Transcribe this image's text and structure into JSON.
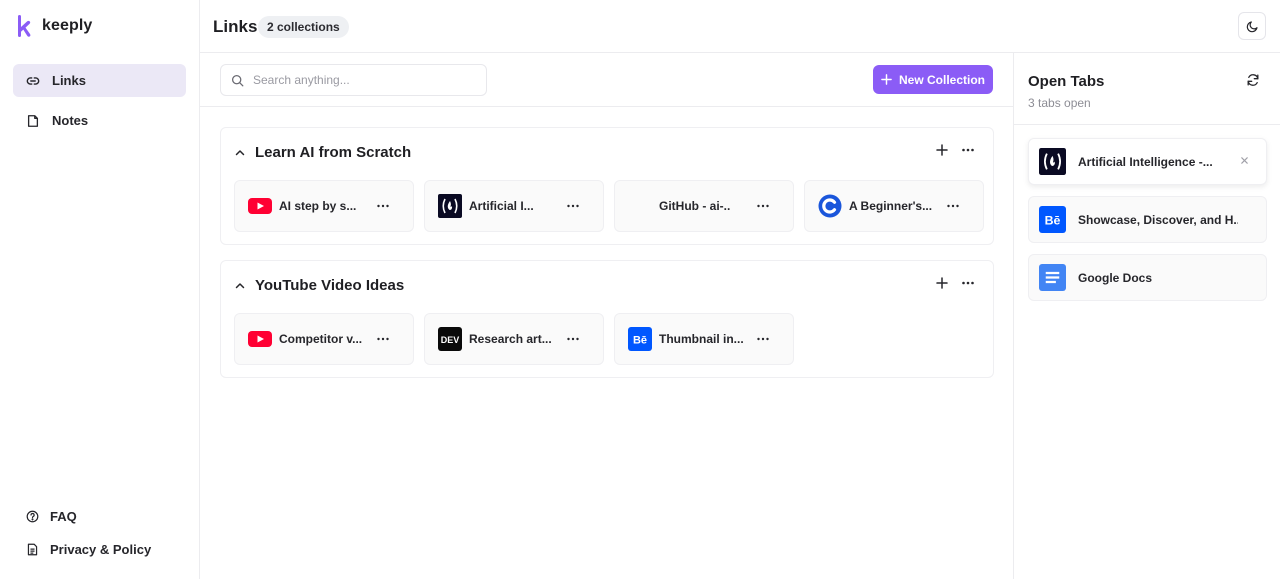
{
  "app": {
    "name": "keeply"
  },
  "sidebar": {
    "items": [
      {
        "label": "Links",
        "icon": "link-icon",
        "active": true
      },
      {
        "label": "Notes",
        "icon": "note-icon",
        "active": false
      }
    ],
    "bottom": [
      {
        "label": "FAQ",
        "icon": "help-circle-icon"
      },
      {
        "label": "Privacy & Policy",
        "icon": "document-icon"
      }
    ]
  },
  "header": {
    "title": "Links",
    "badge": "2 collections"
  },
  "toolbar": {
    "search_placeholder": "Search anything...",
    "new_collection_label": "New Collection"
  },
  "collections": [
    {
      "title": "Learn AI from Scratch",
      "links": [
        {
          "title": "AI step by s...",
          "favicon": "youtube-icon"
        },
        {
          "title": "Artificial I...",
          "favicon": "freecodecamp-icon"
        },
        {
          "title": "GitHub - ai-...",
          "favicon": "none"
        },
        {
          "title": "A Beginner's...",
          "favicon": "c-logo-icon"
        }
      ]
    },
    {
      "title": "YouTube Video Ideas",
      "links": [
        {
          "title": "Competitor v...",
          "favicon": "youtube-icon"
        },
        {
          "title": "Research art...",
          "favicon": "dev-icon"
        },
        {
          "title": "Thumbnail in...",
          "favicon": "behance-icon"
        }
      ]
    }
  ],
  "open_tabs": {
    "title": "Open Tabs",
    "subtitle": "3 tabs open",
    "tabs": [
      {
        "title": "Artificial Intelligence -...",
        "favicon": "freecodecamp-icon"
      },
      {
        "title": "Showcase, Discover, and H...",
        "favicon": "behance-icon"
      },
      {
        "title": "Google Docs",
        "favicon": "google-docs-icon"
      }
    ]
  },
  "colors": {
    "accent": "#8b5cf6",
    "active_nav": "#ebe8f6",
    "youtube": "#ff0033",
    "behance": "#0057ff",
    "docs": "#4285f4"
  },
  "favicon_text": {
    "dev": "DEV",
    "behance": "Bē"
  }
}
